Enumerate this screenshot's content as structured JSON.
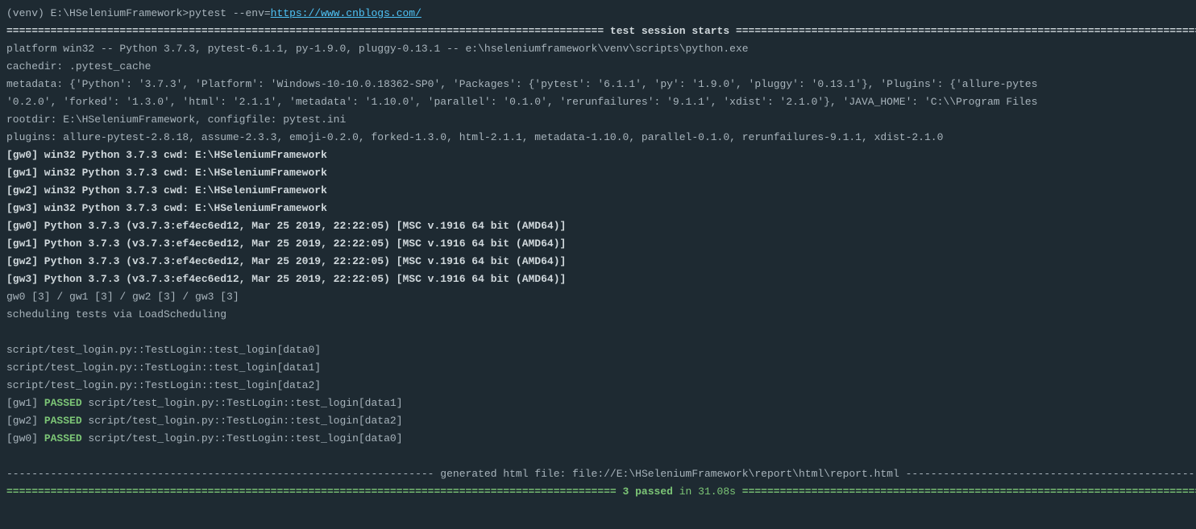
{
  "prompt": {
    "prefix": "(venv) E:\\HSeleniumFramework>",
    "command": "pytest --env=",
    "url": "https://www.cnblogs.com/"
  },
  "session": {
    "rule_left": "=============================================================================================== ",
    "title": "test session starts",
    "rule_right": " ================================================================================================"
  },
  "platform": "platform win32 -- Python 3.7.3, pytest-6.1.1, py-1.9.0, pluggy-0.13.1 -- e:\\hseleniumframework\\venv\\scripts\\python.exe",
  "cachedir": "cachedir: .pytest_cache",
  "metadata": "metadata: {'Python': '3.7.3', 'Platform': 'Windows-10-10.0.18362-SP0', 'Packages': {'pytest': '6.1.1', 'py': '1.9.0', 'pluggy': '0.13.1'}, 'Plugins': {'allure-pytes",
  "metadata2": "'0.2.0', 'forked': '1.3.0', 'html': '2.1.1', 'metadata': '1.10.0', 'parallel': '0.1.0', 'rerunfailures': '9.1.1', 'xdist': '2.1.0'}, 'JAVA_HOME': 'C:\\\\Program Files",
  "rootdir": "rootdir: E:\\HSeleniumFramework, configfile: pytest.ini",
  "plugins": "plugins: allure-pytest-2.8.18, assume-2.3.3, emoji-0.2.0, forked-1.3.0, html-2.1.1, metadata-1.10.0, parallel-0.1.0, rerunfailures-9.1.1, xdist-2.1.0",
  "workers_cwd": [
    "[gw0] win32 Python 3.7.3 cwd: E:\\HSeleniumFramework",
    "[gw1] win32 Python 3.7.3 cwd: E:\\HSeleniumFramework",
    "[gw2] win32 Python 3.7.3 cwd: E:\\HSeleniumFramework",
    "[gw3] win32 Python 3.7.3 cwd: E:\\HSeleniumFramework"
  ],
  "workers_ver": [
    "[gw0] Python 3.7.3 (v3.7.3:ef4ec6ed12, Mar 25 2019, 22:22:05) [MSC v.1916 64 bit (AMD64)]",
    "[gw1] Python 3.7.3 (v3.7.3:ef4ec6ed12, Mar 25 2019, 22:22:05) [MSC v.1916 64 bit (AMD64)]",
    "[gw2] Python 3.7.3 (v3.7.3:ef4ec6ed12, Mar 25 2019, 22:22:05) [MSC v.1916 64 bit (AMD64)]",
    "[gw3] Python 3.7.3 (v3.7.3:ef4ec6ed12, Mar 25 2019, 22:22:05) [MSC v.1916 64 bit (AMD64)]"
  ],
  "slots": "gw0 [3] / gw1 [3] / gw2 [3] / gw3 [3]",
  "scheduling": "scheduling tests via LoadScheduling",
  "tests": [
    "script/test_login.py::TestLogin::test_login[data0]",
    "script/test_login.py::TestLogin::test_login[data1]",
    "script/test_login.py::TestLogin::test_login[data2]"
  ],
  "results": [
    {
      "worker": "[gw1]",
      "status": " PASSED",
      "path": " script/test_login.py::TestLogin::test_login[data1]"
    },
    {
      "worker": "[gw2]",
      "status": " PASSED",
      "path": " script/test_login.py::TestLogin::test_login[data2]"
    },
    {
      "worker": "[gw0]",
      "status": " PASSED",
      "path": " script/test_login.py::TestLogin::test_login[data0]"
    }
  ],
  "html_report": {
    "dash_left": "-------------------------------------------------------------------- ",
    "text": "generated html file: file://E:\\HSeleniumFramework\\report\\html\\report.html",
    "dash_right": " ---------------------------------------------------------------------"
  },
  "summary": {
    "rule_left": "================================================================================================= ",
    "passed": "3 passed",
    "in": " in 31.08s",
    "rule_right": " =================================================================================================="
  }
}
